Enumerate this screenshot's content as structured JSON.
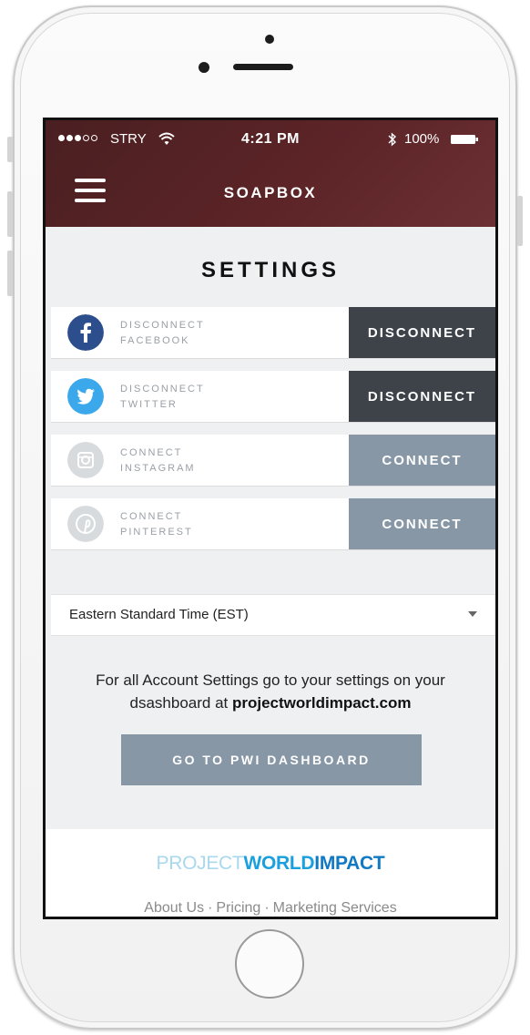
{
  "status_bar": {
    "carrier": "STRY",
    "time": "4:21 PM",
    "battery": "100%"
  },
  "header": {
    "title": "SOAPBOX"
  },
  "page": {
    "title": "SETTINGS"
  },
  "social": [
    {
      "line1": "DISCONNECT",
      "line2": "FACEBOOK",
      "action": "DISCONNECT",
      "icon": "facebook-icon",
      "color": "#2d4e8c"
    },
    {
      "line1": "DISCONNECT",
      "line2": "TWITTER",
      "action": "DISCONNECT",
      "icon": "twitter-icon",
      "color": "#3aa8ea"
    },
    {
      "line1": "CONNECT",
      "line2": "INSTAGRAM",
      "action": "CONNECT",
      "icon": "instagram-icon",
      "color": "#d7dbdd"
    },
    {
      "line1": "CONNECT",
      "line2": "PINTEREST",
      "action": "CONNECT",
      "icon": "pinterest-icon",
      "color": "#d7dbdd"
    }
  ],
  "timezone": {
    "selected": "Eastern Standard Time (EST)"
  },
  "account": {
    "note": "For all Account Settings go to your settings on your dsashboard at ",
    "link": "projectworldimpact.com",
    "button": "GO TO PWI DASHBOARD"
  },
  "footer": {
    "brand_part1": "PROJECT",
    "brand_part2": "WORLD",
    "brand_part3": "IMPACT",
    "links": [
      "About Us",
      "Pricing",
      "Marketing Services"
    ]
  },
  "colors": {
    "header": "#5a2326",
    "dark_button": "#3e434a",
    "light_button": "#8797a6"
  }
}
